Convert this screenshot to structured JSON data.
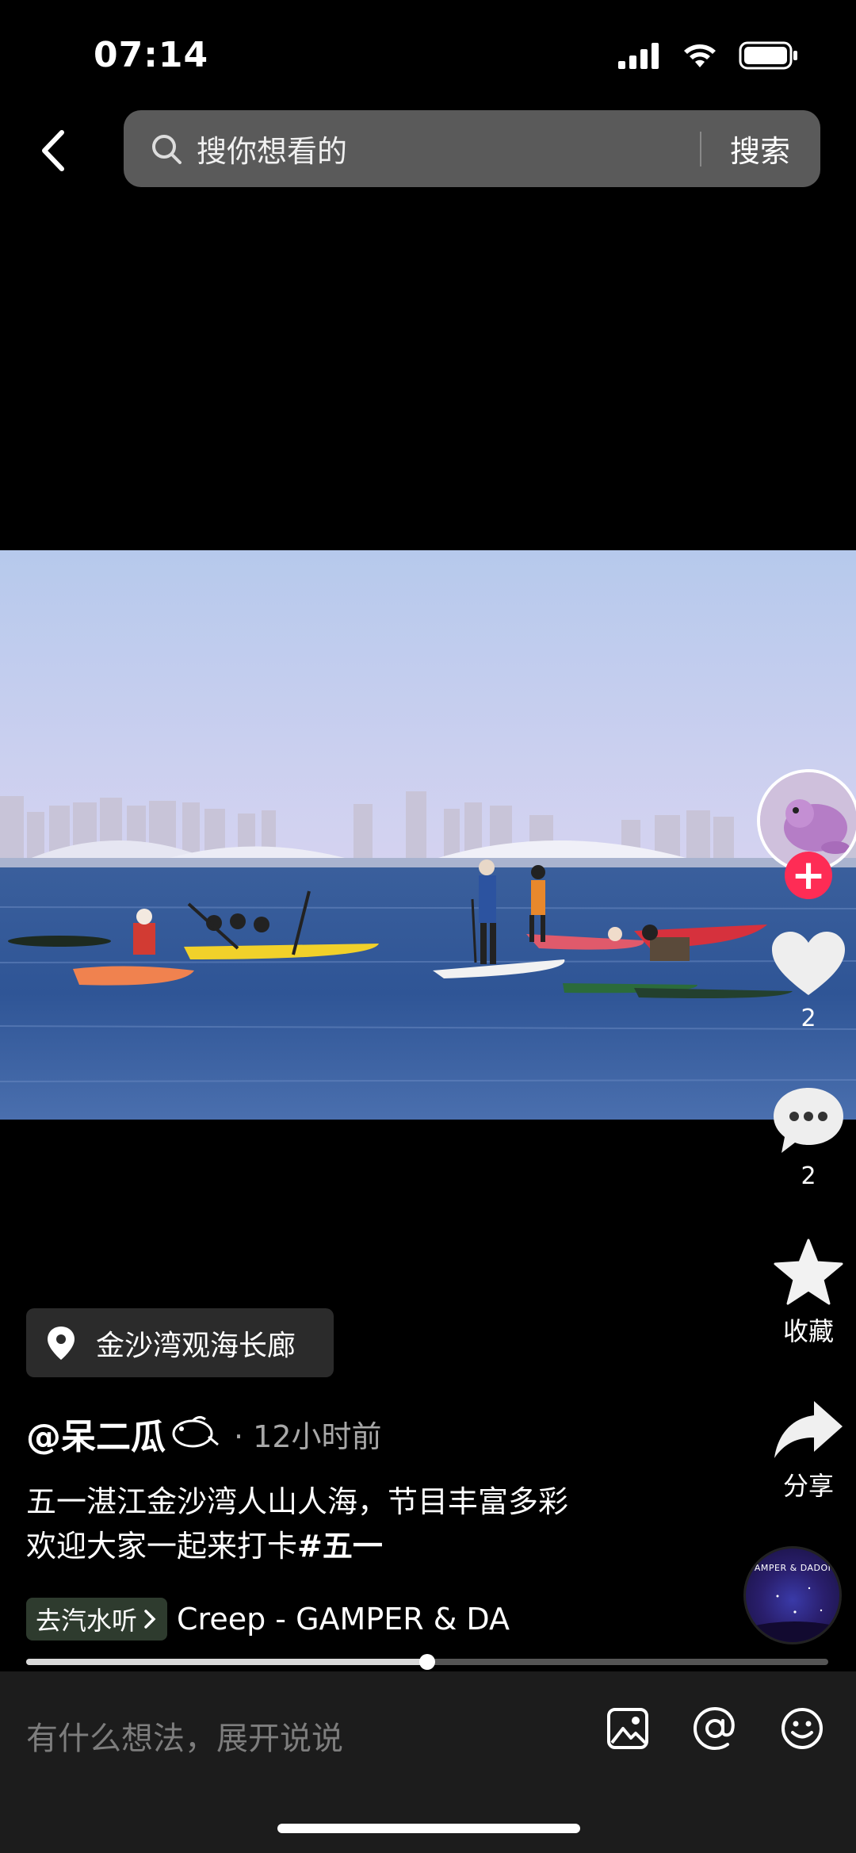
{
  "status_bar": {
    "time": "07:14"
  },
  "search": {
    "placeholder": "搜你想看的",
    "button_label": "搜索"
  },
  "actions": {
    "like_count": "2",
    "comment_count": "2",
    "favorite_label": "收藏",
    "share_label": "分享"
  },
  "location": {
    "name": "金沙湾观海长廊"
  },
  "post": {
    "author": "@呆二瓜",
    "time": "· 12小时前",
    "caption_line1": "五一湛江金沙湾人山人海，节目丰富多彩",
    "caption_line2": "欢迎大家一起来打卡",
    "hashtag": "#五一"
  },
  "music": {
    "chip_label": "去汽水听",
    "title": "Creep - GAMPER & DA",
    "disc_text": "GAMPER & DADONI"
  },
  "playback": {
    "progress": 0.5
  },
  "comment_bar": {
    "placeholder": "有什么想法，展开说说"
  },
  "colors": {
    "follow": "#fe2c55",
    "background": "#000000"
  },
  "icons": [
    "back-chevron-icon",
    "search-icon",
    "location-pin-icon",
    "heart-icon",
    "comment-bubble-icon",
    "star-icon",
    "share-arrow-icon",
    "image-icon",
    "at-icon",
    "emoji-icon"
  ]
}
